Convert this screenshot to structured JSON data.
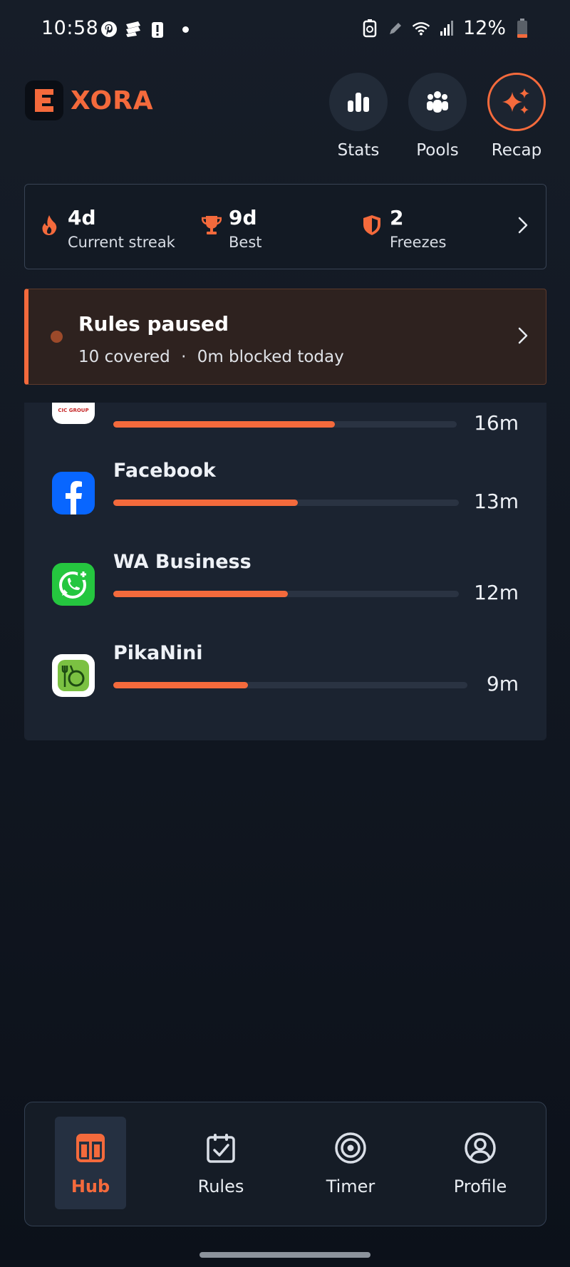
{
  "status_bar": {
    "time": "10:58",
    "battery": "12%",
    "icons": [
      "pinterest-icon",
      "app-icon",
      "alert-icon",
      "dot-icon",
      "recycle-icon",
      "pen-icon",
      "wifi-icon",
      "signal-icon",
      "battery-icon"
    ]
  },
  "brand": {
    "name": "XORA",
    "logo": "E"
  },
  "header_actions": [
    {
      "label": "Stats",
      "icon": "bar-chart-icon"
    },
    {
      "label": "Pools",
      "icon": "group-icon"
    },
    {
      "label": "Recap",
      "icon": "sparkle-icon"
    }
  ],
  "streak": {
    "current": {
      "value": "4d",
      "label": "Current streak"
    },
    "best": {
      "value": "9d",
      "label": "Best"
    },
    "freezes": {
      "value": "2",
      "label": "Freezes"
    }
  },
  "rules": {
    "title": "Rules paused",
    "covered": "10 covered",
    "separator": "·",
    "blocked": "0m blocked today"
  },
  "apps": [
    {
      "name": "",
      "icon_text": "CIC GROUP",
      "time": "16m",
      "usage_fraction": 0.645
    },
    {
      "name": "Facebook",
      "time": "13m",
      "usage_fraction": 0.535
    },
    {
      "name": "WA Business",
      "time": "12m",
      "usage_fraction": 0.505
    },
    {
      "name": "PikaNini",
      "time": "9m",
      "usage_fraction": 0.38
    }
  ],
  "nav": [
    {
      "label": "Hub",
      "icon": "hub-icon",
      "active": true
    },
    {
      "label": "Rules",
      "icon": "calendar-check-icon",
      "active": false
    },
    {
      "label": "Timer",
      "icon": "target-icon",
      "active": false
    },
    {
      "label": "Profile",
      "icon": "profile-icon",
      "active": false
    }
  ],
  "colors": {
    "accent": "#f46a3c",
    "background": "#121822",
    "card": "#1b2330",
    "rules_banner": "#2e221f"
  }
}
